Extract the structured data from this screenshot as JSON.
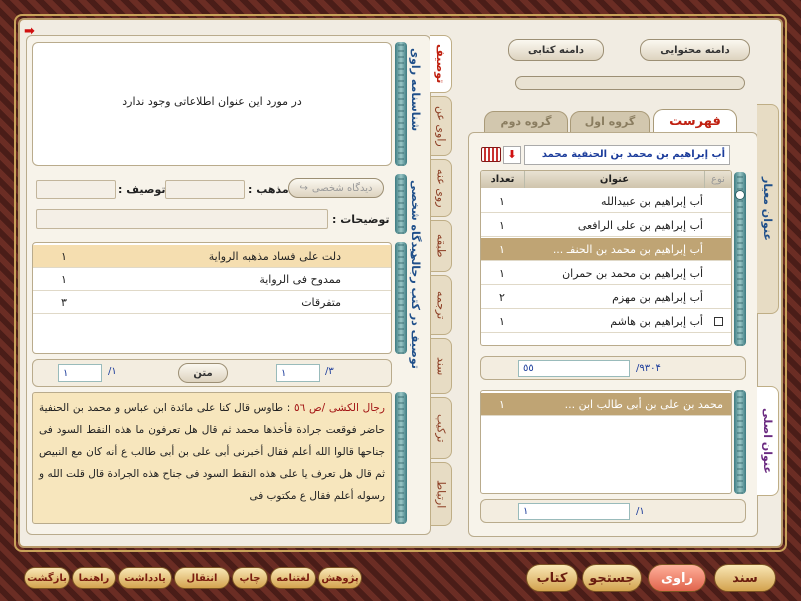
{
  "top_buttons": {
    "content_scope": "دامنه محتوایی",
    "book_scope": "دامنه کتابی"
  },
  "left": {
    "tabs": [
      "توصیف",
      "راوی عن",
      "روی عنه",
      "طبقه",
      "ترجمه",
      "سند",
      "ترکیب",
      "ارتباط"
    ],
    "identity_label": "شناسنامه راوی",
    "identity_text": "در مورد این عنوان اطلاعاتی وجود ندارد",
    "personal_label": "دیدگاه شخصی",
    "personal_button": "دیدگاه شخصی",
    "madhhab_label": "مذهب :",
    "tawsif_label": "توصیف :",
    "tawdihat_label": "توضیحات :",
    "books_label": "توصیف در کتب رجالی",
    "desc_rows": [
      {
        "text": "دلت علی فساد مذهبه الروایة",
        "count": "۱"
      },
      {
        "text": "ممدوح فی الروایة",
        "count": "۱"
      },
      {
        "text": "متفرقات",
        "count": "۳"
      }
    ],
    "pager1": {
      "total": "/۳",
      "current": "۱"
    },
    "matn_button": "متن",
    "pager2": {
      "total": "/۱",
      "current": "۱"
    },
    "source_text": "رجال الکشی ‌/ص ٥٦",
    "matn_text": "طاوس قال کنا علی مائدة ابن عباس و محمد بن الحنفیة حاضر فوقعت جرادة فأخذها محمد ثم قال هل تعرفون ما هذه النقط السود فی جناحها قالوا الله أعلم فقال أخبرنی أبی علی بن أبی طالب ع أنه کان مع النبیص ثم قال هل تعرف یا علی هذه النقط السود فی جناح هذه الجرادة قال قلت الله و رسوله أعلم فقال ع مکتوب فی"
  },
  "right": {
    "tabs": [
      "فهرست",
      "گروه اول",
      "گروه دوم"
    ],
    "side_label_top": "عنوان معیار",
    "side_label_bottom": "عنوان اصلی",
    "search_value": "أب إبراهیم بن محمد بن الحنفیة محمد",
    "columns": {
      "type": "نوع",
      "title": "عنوان",
      "count": "تعداد"
    },
    "rows": [
      {
        "title": "أب إبراهیم بن عبیدالله",
        "count": "۱",
        "checkbox": false
      },
      {
        "title": "أب إبراهیم بن علی الرافعی",
        "count": "۱",
        "checkbox": false
      },
      {
        "title": "أب إبراهیم بن محمد بن الحنفـ ...",
        "count": "۱",
        "checkbox": false
      },
      {
        "title": "أب إبراهیم بن محمد بن حمران",
        "count": "۱",
        "checkbox": false
      },
      {
        "title": "أب إبراهیم بن مهزم",
        "count": "۲",
        "checkbox": false
      },
      {
        "title": "أب إبراهیم بن هاشم",
        "count": "۱",
        "checkbox": true
      }
    ],
    "status_total": "/۹۳۰۴",
    "status_current": "٥٥",
    "main_title_row": {
      "title": "محمد بن علی بن أبی طالب ابن ...",
      "count": "۱"
    },
    "pager_total": "/۱",
    "pager_current": "۱"
  },
  "bottom": {
    "small": [
      "پژوهش",
      "لغتنامه",
      "چاپ",
      "انتقال",
      "یادداشت",
      "راهنما",
      "بازگشت"
    ],
    "big": [
      "کتاب",
      "جستجو",
      "راوی",
      "سند"
    ]
  },
  "colors": {
    "highlight": "#f5deb0",
    "accent": "#c02010",
    "selected_row": "#bfa474"
  }
}
